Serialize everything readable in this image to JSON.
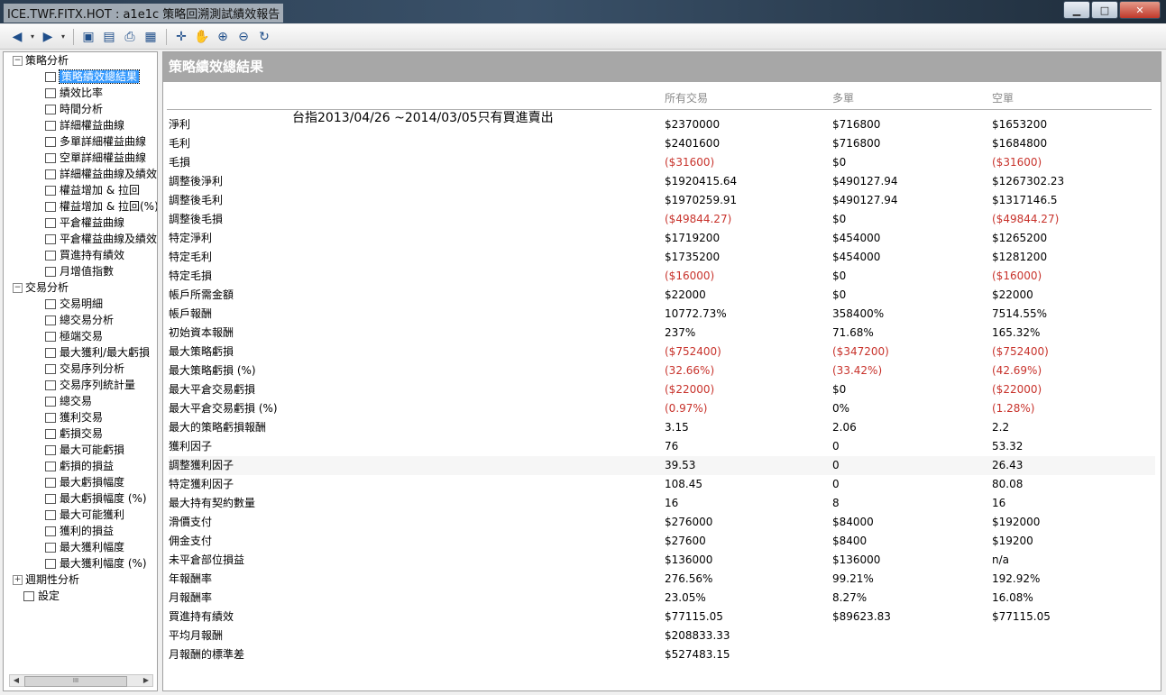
{
  "window": {
    "title": "ICE.TWF.FITX.HOT : a1e1c 策略回溯測試績效報告",
    "minimize": "▁",
    "maximize": "□",
    "close": "✕"
  },
  "toolbar": {
    "icons": [
      "back-icon",
      "dropdown-icon",
      "forward-icon",
      "dropdown-icon",
      "save-icon",
      "export-icon",
      "print-icon",
      "options-icon",
      "crosshair-icon",
      "hand-icon",
      "zoom-in-icon",
      "zoom-out-icon",
      "reset-icon"
    ],
    "glyphs": {
      "back": "◀",
      "forward": "▶",
      "drop": "▾",
      "save": "▣",
      "export": "▤",
      "print": "⎙",
      "options": "▦",
      "cross": "✛",
      "hand": "✋",
      "zoomin": "⊕",
      "zoomout": "⊖",
      "reset": "↻"
    }
  },
  "tree": {
    "groups": [
      {
        "label": "策略分析",
        "expander": "−",
        "items": [
          "策略績效總結果",
          "績效比率",
          "時間分析",
          "詳細權益曲線",
          "多單詳細權益曲線",
          "空單詳細權益曲線",
          "詳細權益曲線及績效",
          "權益增加 & 拉回",
          "權益增加 & 拉回(%)",
          "平倉權益曲線",
          "平倉權益曲線及績效",
          "買進持有績效",
          "月增值指數"
        ]
      },
      {
        "label": "交易分析",
        "expander": "−",
        "items": [
          "交易明細",
          "總交易分析",
          "極端交易",
          "最大獲利/最大虧損",
          "交易序列分析",
          "交易序列統計量",
          "總交易",
          "獲利交易",
          "虧損交易",
          "最大可能虧損",
          "虧損的損益",
          "最大虧損幅度",
          "最大虧損幅度 (%)",
          "最大可能獲利",
          "獲利的損益",
          "最大獲利幅度",
          "最大獲利幅度 (%)"
        ]
      },
      {
        "label": "週期性分析",
        "expander": "+",
        "items": []
      },
      {
        "label": "設定",
        "expander": "",
        "items": []
      }
    ],
    "selected": "策略績效總結果",
    "scroll_thumb": "III",
    "scroll_left": "◀",
    "scroll_right": "▶"
  },
  "report": {
    "header": "策略績效總結果",
    "columns": [
      "所有交易",
      "多單",
      "空單"
    ],
    "note": "台指2013/04/26 ~2014/03/05只有買進賣出",
    "rows": [
      {
        "label": "淨利",
        "all": "$2370000",
        "long": "$716800",
        "short": "$1653200"
      },
      {
        "label": "毛利",
        "all": "$2401600",
        "long": "$716800",
        "short": "$1684800"
      },
      {
        "label": "毛損",
        "all": "($31600)",
        "long": "$0",
        "short": "($31600)"
      },
      {
        "label": "調整後淨利",
        "all": "$1920415.64",
        "long": "$490127.94",
        "short": "$1267302.23"
      },
      {
        "label": "調整後毛利",
        "all": "$1970259.91",
        "long": "$490127.94",
        "short": "$1317146.5"
      },
      {
        "label": "調整後毛損",
        "all": "($49844.27)",
        "long": "$0",
        "short": "($49844.27)"
      },
      {
        "label": "特定淨利",
        "all": "$1719200",
        "long": "$454000",
        "short": "$1265200"
      },
      {
        "label": "特定毛利",
        "all": "$1735200",
        "long": "$454000",
        "short": "$1281200"
      },
      {
        "label": "特定毛損",
        "all": "($16000)",
        "long": "$0",
        "short": "($16000)"
      },
      {
        "label": "帳戶所需金額",
        "all": "$22000",
        "long": "$0",
        "short": "$22000"
      },
      {
        "label": "帳戶報酬",
        "all": "10772.73%",
        "long": "358400%",
        "short": "7514.55%"
      },
      {
        "label": "初始資本報酬",
        "all": "237%",
        "long": "71.68%",
        "short": "165.32%"
      },
      {
        "label": "最大策略虧損",
        "all": "($752400)",
        "long": "($347200)",
        "short": "($752400)"
      },
      {
        "label": "最大策略虧損 (%)",
        "all": "(32.66%)",
        "long": "(33.42%)",
        "short": "(42.69%)"
      },
      {
        "label": "最大平倉交易虧損",
        "all": "($22000)",
        "long": "$0",
        "short": "($22000)"
      },
      {
        "label": "最大平倉交易虧損 (%)",
        "all": "(0.97%)",
        "long": "0%",
        "short": "(1.28%)"
      },
      {
        "label": "最大的策略虧損報酬",
        "all": "3.15",
        "long": "2.06",
        "short": "2.2"
      },
      {
        "label": "獲利因子",
        "all": "76",
        "long": "0",
        "short": "53.32"
      },
      {
        "label": "調整獲利因子",
        "all": "39.53",
        "long": "0",
        "short": "26.43"
      },
      {
        "label": "特定獲利因子",
        "all": "108.45",
        "long": "0",
        "short": "80.08"
      },
      {
        "label": "最大持有契約數量",
        "all": "16",
        "long": "8",
        "short": "16"
      },
      {
        "label": "滑價支付",
        "all": "$276000",
        "long": "$84000",
        "short": "$192000"
      },
      {
        "label": "佣金支付",
        "all": "$27600",
        "long": "$8400",
        "short": "$19200"
      },
      {
        "label": "未平倉部位損益",
        "all": "$136000",
        "long": "$136000",
        "short": "n/a"
      },
      {
        "label": "年報酬率",
        "all": "276.56%",
        "long": "99.21%",
        "short": "192.92%"
      },
      {
        "label": "月報酬率",
        "all": "23.05%",
        "long": "8.27%",
        "short": "16.08%"
      },
      {
        "label": "買進持有績效",
        "all": "$77115.05",
        "long": "$89623.83",
        "short": "$77115.05"
      },
      {
        "label": "平均月報酬",
        "all": "$208833.33",
        "long": "",
        "short": ""
      },
      {
        "label": "月報酬的標準差",
        "all": "$527483.15",
        "long": "",
        "short": ""
      }
    ],
    "highlight_row": "調整獲利因子"
  }
}
